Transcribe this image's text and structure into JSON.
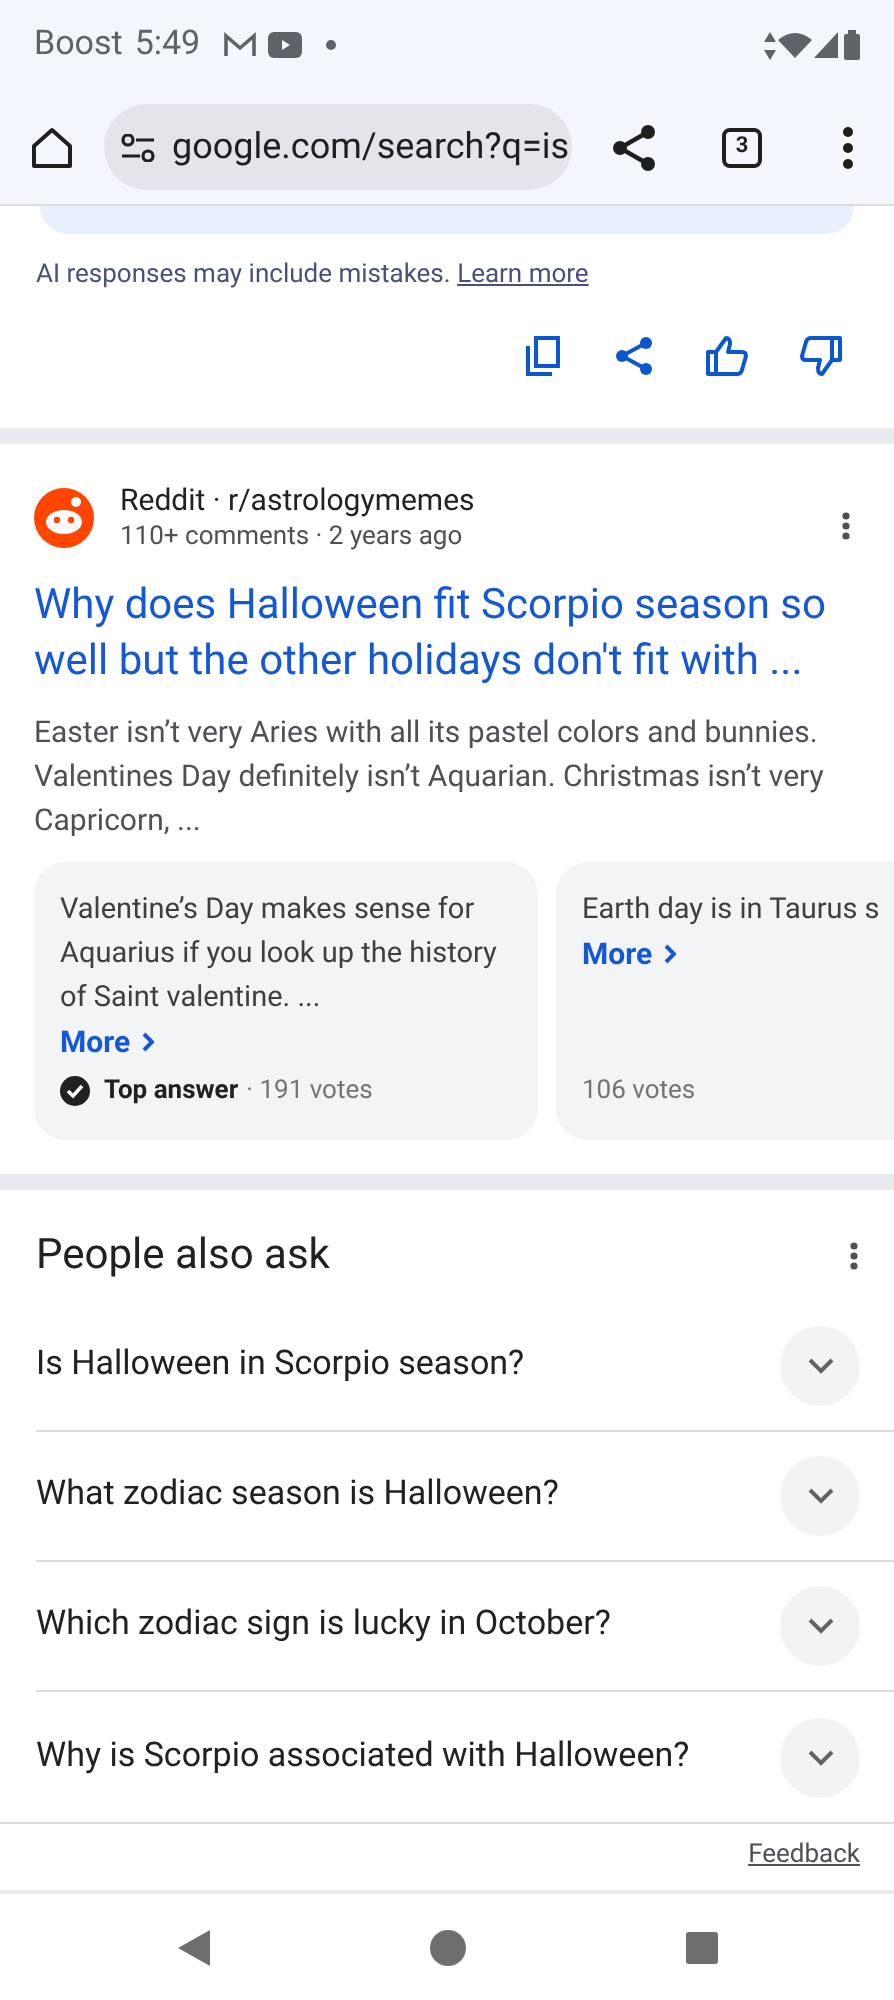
{
  "status_bar": {
    "carrier": "Boost",
    "time": "5:49"
  },
  "toolbar": {
    "url": "google.com/search?q=is",
    "tab_count": "3"
  },
  "ai_overview": {
    "disclaimer": "AI responses may include mistakes.",
    "link": "Learn more"
  },
  "result": {
    "source": "Reddit · r/astrologymemes",
    "meta": "110+ comments · 2 years ago",
    "title": "Why does Halloween fit Scorpio season so well but the other holidays don't fit with ...",
    "snippet": "Easter isn’t very Aries with all its pastel colors and bunnies. Valentines Day definitely isn’t Aquarian. Christmas isn’t very Capricorn, ...",
    "answers": [
      {
        "text": "Valentine’s Day makes sense for Aquarius if you look up the history of Saint valentine. ...",
        "more": "More",
        "badge": "Top answer",
        "votes": "· 191 votes"
      },
      {
        "text": "Earth day is in Taurus s",
        "more": "More",
        "votes": "106 votes"
      }
    ]
  },
  "people_also_ask": {
    "title": "People also ask",
    "questions": [
      {
        "text": "Is Halloween in Scorpio season?",
        "expanded": false
      },
      {
        "text": "What zodiac season is Halloween?",
        "expanded": false
      },
      {
        "text": "Which zodiac sign is lucky in October?",
        "expanded": false
      },
      {
        "text": "Why is Scorpio associated with Halloween?",
        "expanded": false
      }
    ],
    "feedback": "Feedback"
  }
}
